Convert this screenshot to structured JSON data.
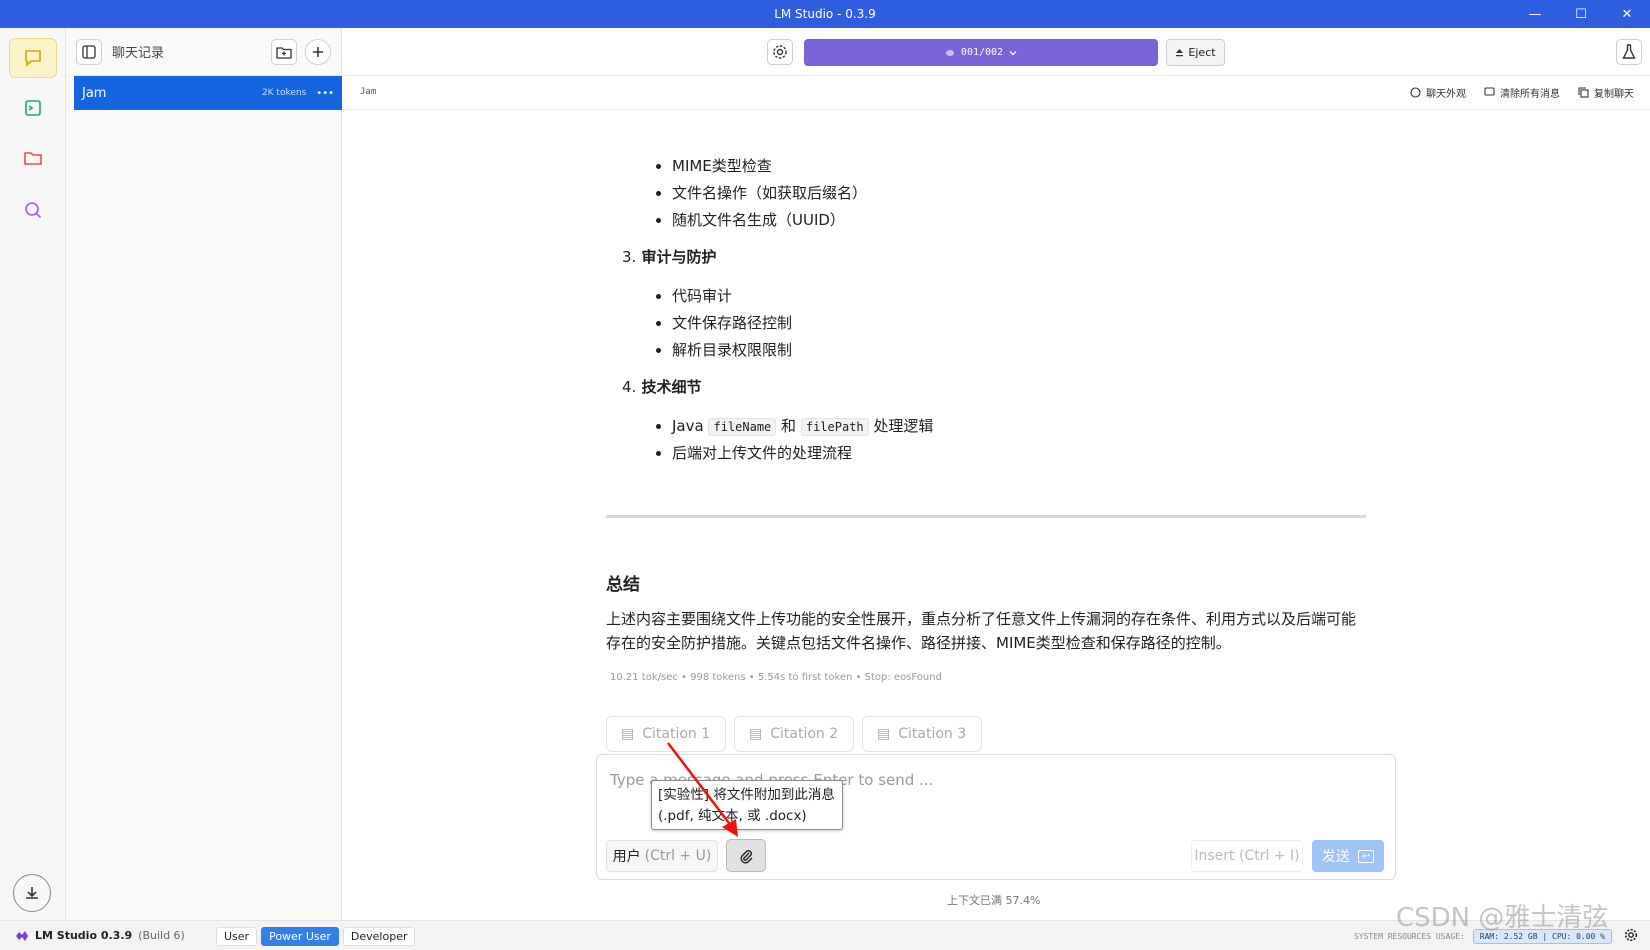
{
  "window": {
    "title": "LM Studio - 0.3.9",
    "ctrl_min": "—",
    "ctrl_max": "☐",
    "ctrl_close": "✕"
  },
  "sidebar": {
    "title": "聊天记录",
    "chats": [
      {
        "name": "Jam",
        "tokens": "2K tokens",
        "menu": "•••"
      }
    ]
  },
  "topbar": {
    "model_label": "001/002",
    "eject_label": "Eject"
  },
  "chat_header": {
    "name": "Jam",
    "actions": [
      "聊天外观",
      "清除所有消息",
      "复制聊天"
    ]
  },
  "message": {
    "section2_items": [
      "MIME类型检查",
      "文件名操作（如获取后缀名）",
      "随机文件名生成（UUID）"
    ],
    "section3_num": "3.",
    "section3_title": "审计与防护",
    "section3_items": [
      "代码审计",
      "文件保存路径控制",
      "解析目录权限限制"
    ],
    "section4_num": "4.",
    "section4_title": "技术细节",
    "section4_java_prefix": "Java",
    "section4_code1": "fileName",
    "section4_and": "和",
    "section4_code2": "filePath",
    "section4_java_suffix": "处理逻辑",
    "section4_item2": "后端对上传文件的处理流程",
    "summary_title": "总结",
    "summary_text": "上述内容主要围绕文件上传功能的安全性展开，重点分析了任意文件上传漏洞的存在条件、利用方式以及后端可能存在的安全防护措施。关键点包括文件名操作、路径拼接、MIME类型检查和保存路径的控制。",
    "stats": "10.21 tok/sec • 998 tokens • 5.54s to first token • Stop: eosFound",
    "citations": [
      "Citation 1",
      "Citation 2",
      "Citation 3"
    ]
  },
  "composer": {
    "placeholder": "Type a message and press Enter to send ...",
    "role_label": "用户",
    "role_hotkey": "(Ctrl + U)",
    "insert_label": "Insert",
    "insert_hotkey": "(Ctrl + I)",
    "send_label": "发送",
    "tooltip_line1": "[实验性] 将文件附加到此消息",
    "tooltip_line2": "(.pdf, 纯文本, 或 .docx)"
  },
  "context_usage": "上下文已满 57.4%",
  "statusbar": {
    "app_name": "LM Studio 0.3.9",
    "build": "(Build 6)",
    "modes": [
      "User",
      "Power User",
      "Developer"
    ],
    "active_mode": "Power User",
    "sys_label": "SYSTEM RESOURCES USAGE:",
    "ram": "RAM: 2.52 GB | CPU: 0.00 %"
  },
  "watermark": "CSDN @雅士清弦",
  "colors": {
    "titlebar": "#2f5fe0",
    "model_selector": "#7a63d9",
    "active_chat": "#1565e0",
    "send": "#9ec3f5"
  }
}
